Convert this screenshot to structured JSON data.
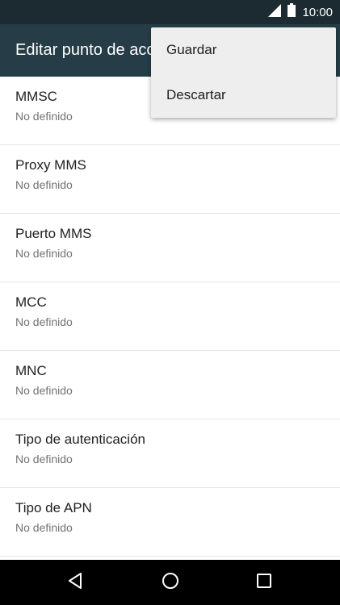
{
  "status_bar": {
    "time": "10:00",
    "icons": [
      "signal-icon",
      "battery-icon"
    ]
  },
  "app_bar": {
    "title": "Editar punto de acceso"
  },
  "menu": {
    "items": [
      {
        "label": "Guardar"
      },
      {
        "label": "Descartar"
      }
    ]
  },
  "settings": [
    {
      "label": "MMSC",
      "value": "No definido"
    },
    {
      "label": "Proxy MMS",
      "value": "No definido"
    },
    {
      "label": "Puerto MMS",
      "value": "No definido"
    },
    {
      "label": "MCC",
      "value": "No definido"
    },
    {
      "label": "MNC",
      "value": "No definido"
    },
    {
      "label": "Tipo de autenticación",
      "value": "No definido"
    },
    {
      "label": "Tipo de APN",
      "value": "No definido"
    }
  ],
  "nav_bar": {
    "buttons": [
      "back-icon",
      "home-icon",
      "recents-icon"
    ]
  },
  "colors": {
    "status_bar": "#1c2a31",
    "app_bar": "#263d47",
    "menu_bg": "#eeeeee",
    "nav_bar": "#000000"
  }
}
